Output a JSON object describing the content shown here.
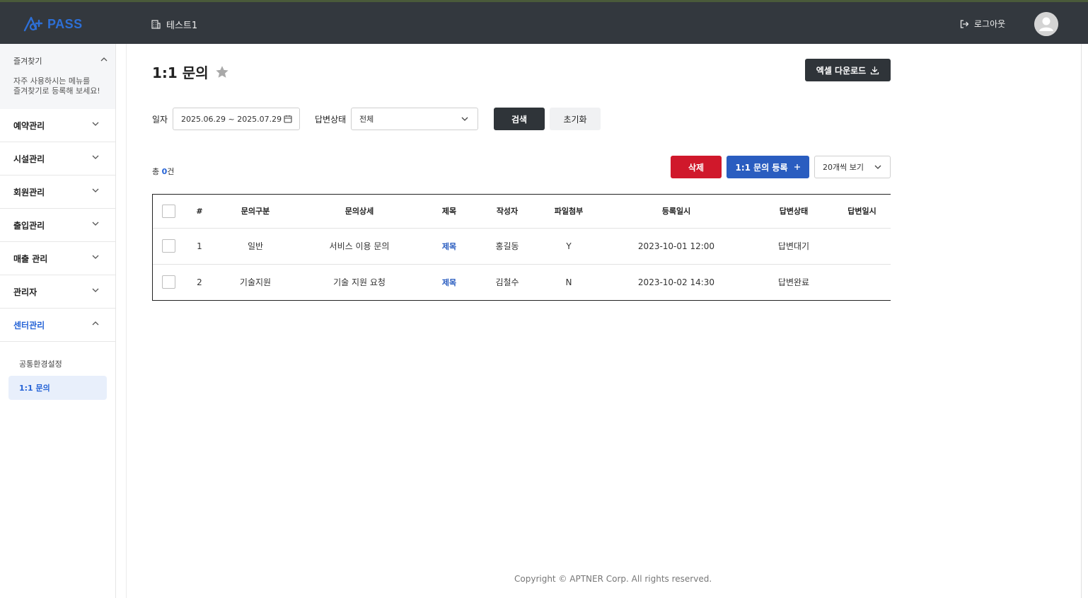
{
  "header": {
    "logo_text": "PASS",
    "site_name": "테스트1",
    "logout_label": "로그아웃"
  },
  "sidebar": {
    "favorites": {
      "title": "즐겨찾기",
      "desc_line1": "자주 사용하시는 메뉴를",
      "desc_line2": "즐겨찾기로 등록해 보세요!"
    },
    "items": [
      {
        "label": "예약관리"
      },
      {
        "label": "시설관리"
      },
      {
        "label": "회원관리"
      },
      {
        "label": "출입관리"
      },
      {
        "label": "매출 관리"
      },
      {
        "label": "관리자"
      },
      {
        "label": "센터관리"
      }
    ],
    "sub_items": [
      {
        "label": "공통환경설정"
      },
      {
        "label": "1:1 문의"
      }
    ]
  },
  "page": {
    "title": "1:1 문의",
    "excel_label": "엑셀 다운로드"
  },
  "filters": {
    "date_label": "일자",
    "date_value": "2025.06.29 ~ 2025.07.29",
    "status_label": "답변상태",
    "status_value": "전체",
    "search_label": "검색",
    "reset_label": "초기화"
  },
  "list": {
    "count_prefix": "총 ",
    "count_value": "0",
    "count_suffix": "건",
    "delete_label": "삭제",
    "add_label": "1:1 문의 등록",
    "pagesize_label": "20개씩 보기"
  },
  "table": {
    "headers": [
      "#",
      "문의구분",
      "문의상세",
      "제목",
      "작성자",
      "파일첨부",
      "등록일시",
      "답변상태",
      "답변일시"
    ],
    "rows": [
      {
        "no": "1",
        "category": "일반",
        "detail": "서비스 이용 문의",
        "title": "제목",
        "author": "홍길동",
        "file": "Y",
        "created": "2023-10-01 12:00",
        "status": "답변대기",
        "answered": ""
      },
      {
        "no": "2",
        "category": "기술지원",
        "detail": "기술 지원 요청",
        "title": "제목",
        "author": "김철수",
        "file": "N",
        "created": "2023-10-02 14:30",
        "status": "답변완료",
        "answered": ""
      }
    ]
  },
  "footer": {
    "copyright": "Copyright © APTNER Corp. All rights reserved."
  }
}
